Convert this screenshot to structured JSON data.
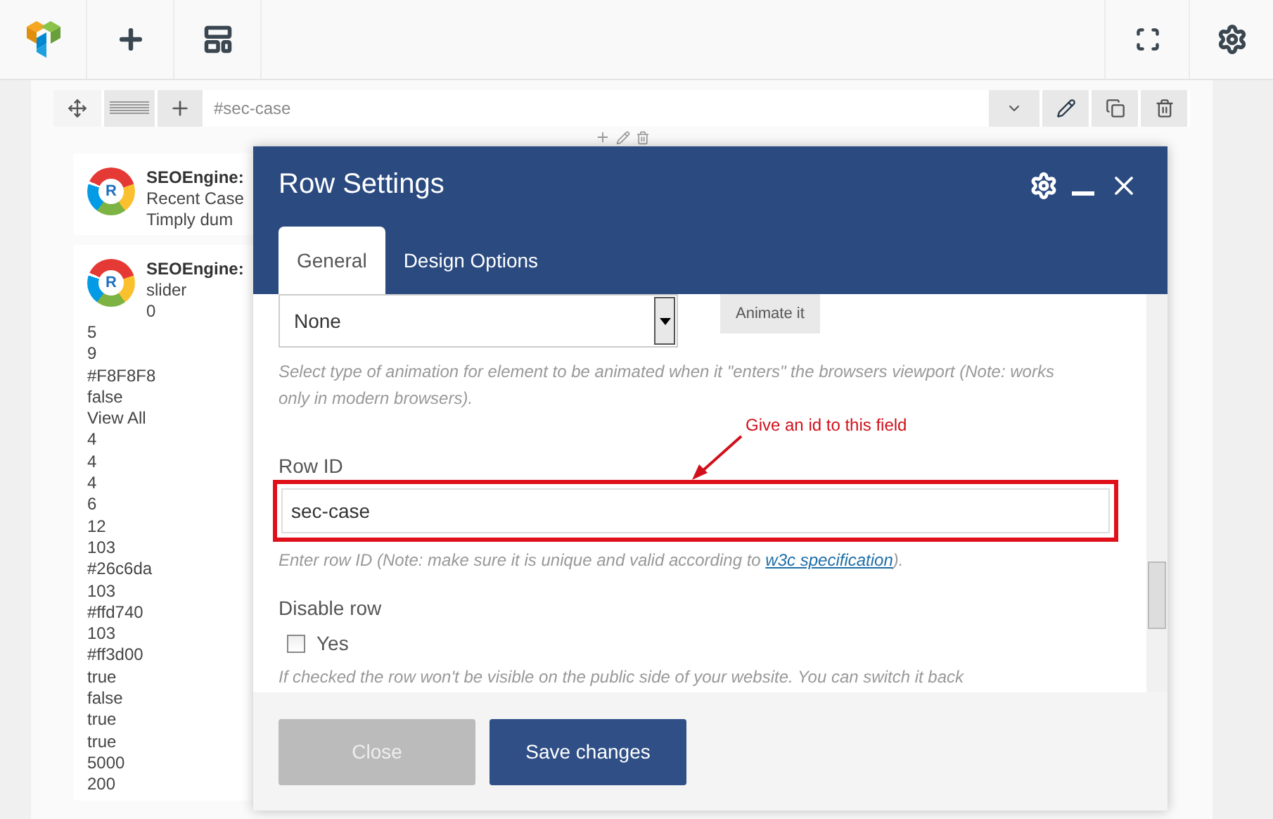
{
  "row_header": {
    "row_id": "#sec-case"
  },
  "elements": [
    {
      "title": "SEOEngine:",
      "logo_letter": "R",
      "lines": [
        "Recent Case",
        "Timply dum"
      ]
    },
    {
      "title": "SEOEngine:",
      "logo_letter": "R",
      "lines": [
        "slider",
        "0"
      ],
      "values": [
        "5",
        "9",
        "#F8F8F8",
        "false",
        "View All",
        "4",
        "4",
        "4",
        "6",
        "12",
        "103",
        "#26c6da",
        "103",
        "#ffd740",
        "103",
        "#ff3d00",
        "true",
        "false",
        "true",
        "true",
        "5000",
        "200"
      ]
    }
  ],
  "modal": {
    "title": "Row Settings",
    "tabs": [
      {
        "label": "General",
        "selected": true
      },
      {
        "label": "Design Options",
        "selected": false
      }
    ],
    "animation": {
      "value": "None",
      "button": "Animate it",
      "hint": "Select type of animation for element to be animated when it \"enters\" the browsers viewport (Note: works only in modern browsers)."
    },
    "annotation": "Give an id to this field",
    "row_id": {
      "label": "Row ID",
      "value": "sec-case",
      "hint_before": "Enter row ID (Note: make sure it is unique and valid according to ",
      "link": "w3c specification",
      "hint_after": ")."
    },
    "disable_row": {
      "label": "Disable row",
      "option": "Yes",
      "checked": false,
      "hint": "If checked the row won't be visible on the public side of your website. You can switch it back"
    },
    "buttons": [
      {
        "label": "Close",
        "disabled": true
      },
      {
        "label": "Save changes",
        "disabled": false
      }
    ]
  }
}
